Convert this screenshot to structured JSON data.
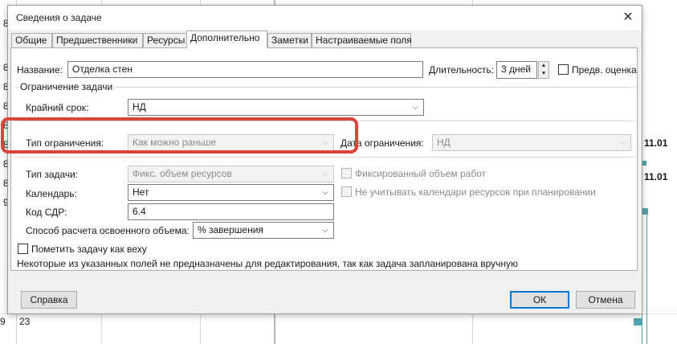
{
  "background": {
    "left_numbers": [
      "8",
      "8",
      "8",
      "8",
      "8",
      "8",
      "8",
      "8",
      "9",
      "9"
    ],
    "bottom_number": "23",
    "dates": [
      "11.01",
      "11.01"
    ]
  },
  "dialog": {
    "title": "Сведения о задаче",
    "tabs": [
      "Общие",
      "Предшественники",
      "Ресурсы",
      "Дополнительно",
      "Заметки",
      "Настраиваемые поля"
    ],
    "active_tab": "Дополнительно",
    "name_label": "Название:",
    "name_value": "Отделка стен",
    "duration_label": "Длительность:",
    "duration_value": "3 дней",
    "estimate_label": "Предв. оценка",
    "constraint_group": "Ограничение задачи",
    "deadline_label": "Крайний срок:",
    "deadline_value": "НД",
    "constraint_type_label": "Тип ограничения:",
    "constraint_type_value": "Как можно раньше",
    "constraint_date_label": "Дата ограничения:",
    "constraint_date_value": "НД",
    "task_type_label": "Тип задачи:",
    "task_type_value": "Фикс. объем ресурсов",
    "effort_driven_label": "Фиксированный объем работ",
    "calendar_label": "Календарь:",
    "calendar_value": "Нет",
    "ignore_calendars_label": "Не учитывать календари ресурсов при планировании",
    "wbs_label": "Код СДР:",
    "wbs_value": "6.4",
    "earned_value_label": "Способ расчета освоенного объема:",
    "earned_value_value": "% завершения",
    "milestone_label": "Пометить задачу как веху",
    "note": "Некоторые из указанных полей не предназначены для редактирования, так как задача запланирована вручную",
    "help_button": "Справка",
    "ok_button": "ОК",
    "cancel_button": "Отмена"
  },
  "colors": {
    "highlight": "#d9453c",
    "gantt": "#4fa3b0",
    "ok_border": "#0078d7"
  }
}
